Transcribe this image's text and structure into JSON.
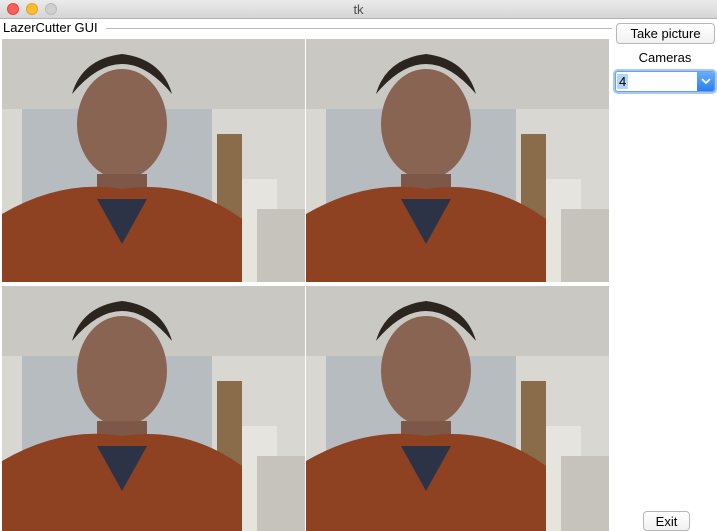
{
  "window": {
    "title": "tk"
  },
  "frame": {
    "label": "LazerCutter GUI"
  },
  "feeds": [
    {
      "name": "camera-feed-1"
    },
    {
      "name": "camera-feed-2"
    },
    {
      "name": "camera-feed-3"
    },
    {
      "name": "camera-feed-4"
    }
  ],
  "panel": {
    "take_picture_label": "Take picture",
    "cameras_label": "Cameras",
    "cameras_value": "4",
    "exit_label": "Exit"
  },
  "colors": {
    "close": "#fc5f57",
    "minimize": "#fdbc2e",
    "select_accent": "#2a7ff0"
  },
  "icons": [
    "close-icon",
    "minimize-icon",
    "zoom-icon",
    "chevron-down-icon"
  ]
}
